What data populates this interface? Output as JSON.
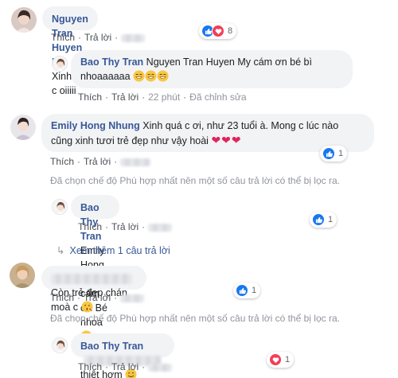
{
  "comments": [
    {
      "author": "Nguyen Tran Huyen My",
      "text": "Xinh qa c oiiiii",
      "actions": [
        "Thích",
        "Trả lời"
      ],
      "reactions": {
        "count": "8",
        "types": [
          "like",
          "love"
        ]
      }
    },
    {
      "author": "Bao Thy Tran",
      "mention": "Nguyen Tran Huyen My",
      "text_line1": "cám ơn bé bì",
      "text_line2": "nhoaaaaaa",
      "actions": [
        "Thích",
        "Trả lời"
      ],
      "time": "22 phút",
      "edited": "Đã chỉnh sửa"
    },
    {
      "author": "Emily Hong Nhung",
      "text_line1": "Xinh quá c ơi, như 23 tuổi à. Mong c lúc nào",
      "text_line2": "cũng xinh tươi trẻ đẹp như vậy hoài",
      "actions": [
        "Thích",
        "Trả lời"
      ],
      "reactions": {
        "count": "1",
        "types": [
          "like"
        ]
      }
    },
    {
      "author": "Bao Thy Tran",
      "mention": "Emily Hong Nhung",
      "text": "cám ơn Bé nhoa",
      "actions": [
        "Thích",
        "Trả lời"
      ],
      "reactions": {
        "count": "1",
        "types": [
          "like"
        ]
      }
    },
    {
      "text": "Còn trẻ đẹp chán moà c",
      "actions": [
        "Thích",
        "Trả lời"
      ],
      "reactions": {
        "count": "1",
        "types": [
          "like"
        ]
      }
    },
    {
      "author": "Bao Thy Tran",
      "text": "thiệt hơm",
      "actions": [
        "Thích",
        "Trả lời"
      ],
      "reactions": {
        "count": "1",
        "types": [
          "love"
        ]
      }
    }
  ],
  "filter_notice": "Đã chọn chế độ Phù hợp nhất nên một số câu trả lời có thể bị lọc ra.",
  "view_more": "Xem thêm 1 câu trả lời",
  "colors": {
    "name": "#385898",
    "bubble": "#f2f3f5",
    "like": "#1877f2",
    "love": "#f33e58"
  }
}
